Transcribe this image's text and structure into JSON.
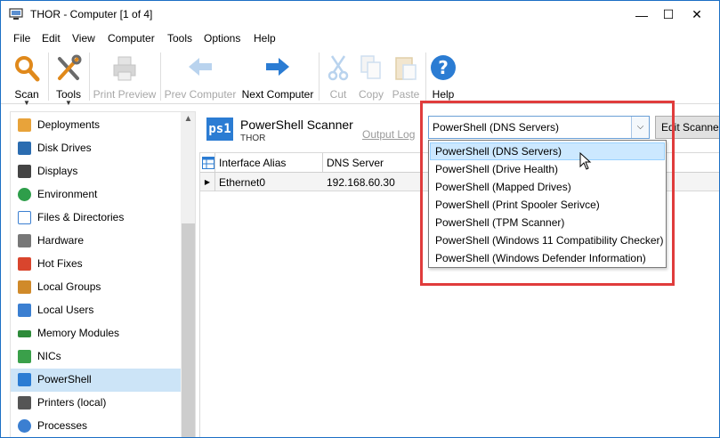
{
  "window": {
    "title": "THOR - Computer [1 of 4]",
    "minimize": "—",
    "maximize": "☐",
    "close": "✕"
  },
  "menu": [
    "File",
    "Edit",
    "View",
    "Computer",
    "Tools",
    "Options",
    "Help"
  ],
  "toolbar": {
    "scan": "Scan",
    "tools": "Tools",
    "print_preview": "Print Preview",
    "prev_computer": "Prev Computer",
    "next_computer": "Next Computer",
    "cut": "Cut",
    "copy": "Copy",
    "paste": "Paste",
    "help": "Help"
  },
  "sidebar": {
    "items": [
      {
        "label": "Deployments",
        "icon": "deployments-icon",
        "color": "#e8a33a"
      },
      {
        "label": "Disk Drives",
        "icon": "disk-drive-icon",
        "color": "#2b6cb0"
      },
      {
        "label": "Displays",
        "icon": "display-icon",
        "color": "#444444"
      },
      {
        "label": "Environment",
        "icon": "environment-icon",
        "color": "#2e9e4a"
      },
      {
        "label": "Files & Directories",
        "icon": "files-icon",
        "color": "#3b7fd1"
      },
      {
        "label": "Hardware",
        "icon": "hardware-icon",
        "color": "#777777"
      },
      {
        "label": "Hot Fixes",
        "icon": "hotfix-icon",
        "color": "#d9452d"
      },
      {
        "label": "Local Groups",
        "icon": "local-groups-icon",
        "color": "#d08a2a"
      },
      {
        "label": "Local Users",
        "icon": "local-users-icon",
        "color": "#3b7fd1"
      },
      {
        "label": "Memory Modules",
        "icon": "memory-icon",
        "color": "#2e8b3a"
      },
      {
        "label": "NICs",
        "icon": "nic-icon",
        "color": "#3aa04a"
      },
      {
        "label": "PowerShell",
        "icon": "powershell-icon",
        "color": "#2b7cd3"
      },
      {
        "label": "Printers (local)",
        "icon": "printer-icon",
        "color": "#555555"
      },
      {
        "label": "Processes",
        "icon": "processes-icon",
        "color": "#3b7fd1"
      }
    ],
    "selected": "PowerShell"
  },
  "scanner": {
    "logo": "ps1",
    "title": "PowerShell Scanner",
    "subtitle": "THOR",
    "output_log": "Output Log",
    "combo_value": "PowerShell (DNS Servers)",
    "edit_button": "Edit Scanner"
  },
  "grid": {
    "columns": [
      "Interface Alias",
      "DNS Server"
    ],
    "rows": [
      {
        "alias": "Ethernet0",
        "dns": "192.168.60.30"
      }
    ]
  },
  "dropdown": {
    "options": [
      "PowerShell (DNS Servers)",
      "PowerShell (Drive Health)",
      "PowerShell (Mapped Drives)",
      "PowerShell (Print Spooler Serivce)",
      "PowerShell (TPM Scanner)",
      "PowerShell (Windows 11 Compatibility Checker)",
      "PowerShell (Windows Defender Information)"
    ],
    "selected_index": 0
  },
  "colors": {
    "accent": "#1c6fc4",
    "selection": "#cce4f7",
    "highlight_border": "#e03c3c"
  }
}
